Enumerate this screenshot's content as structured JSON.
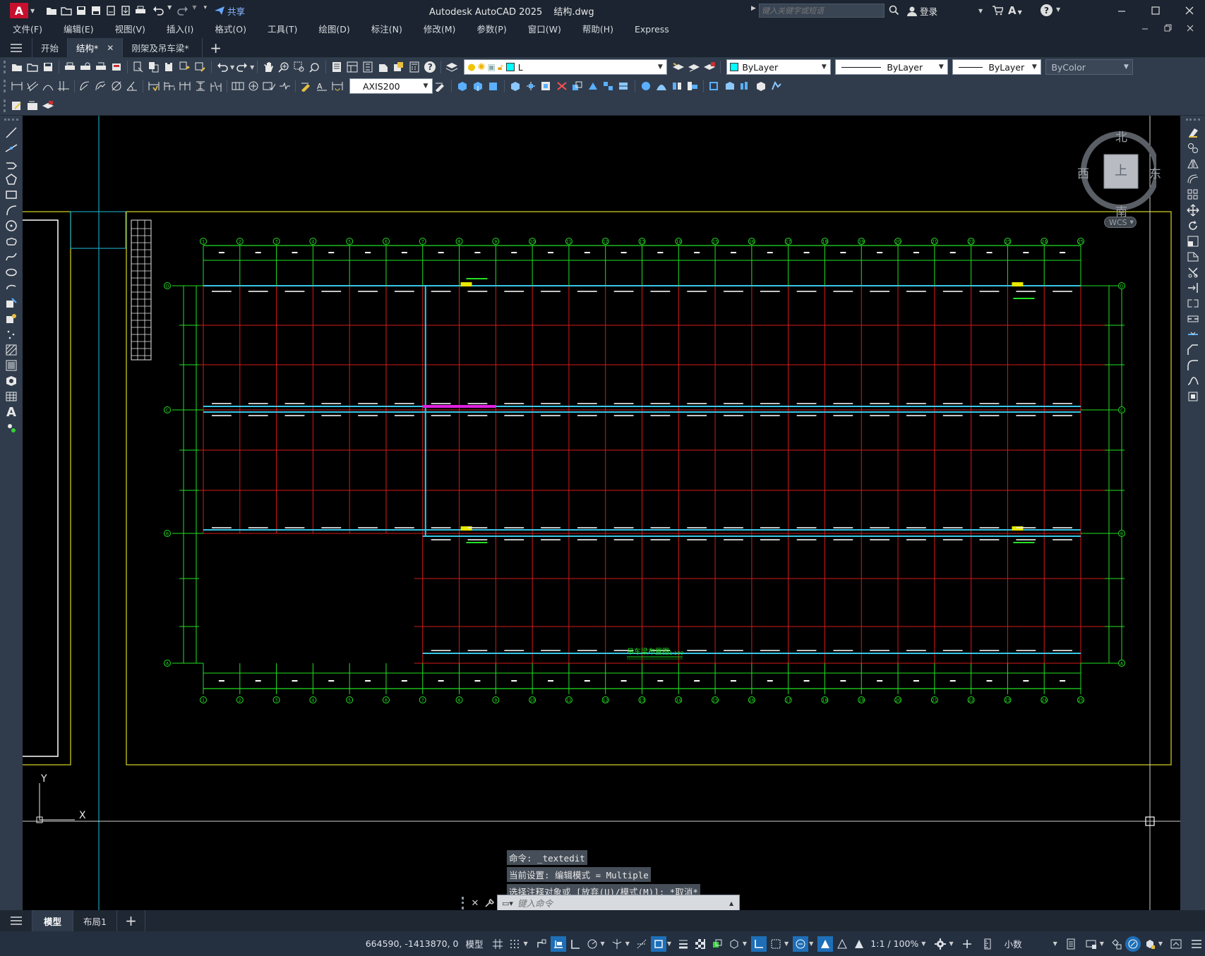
{
  "window": {
    "app_title": "Autodesk AutoCAD 2025",
    "file_name": "结构.dwg",
    "search_placeholder": "键入关键字或短语",
    "share_label": "共享",
    "login_label": "登录"
  },
  "menu": [
    "文件(F)",
    "编辑(E)",
    "视图(V)",
    "插入(I)",
    "格式(O)",
    "工具(T)",
    "绘图(D)",
    "标注(N)",
    "修改(M)",
    "参数(P)",
    "窗口(W)",
    "帮助(H)",
    "Express"
  ],
  "doc_tabs": [
    {
      "label": "开始",
      "active": false,
      "close": false
    },
    {
      "label": "结构*",
      "active": true,
      "close": true
    },
    {
      "label": "刚架及吊车梁*",
      "active": false,
      "close": false
    }
  ],
  "toolbar": {
    "layer_name": "L",
    "color": "ByLayer",
    "linetype": "ByLayer",
    "lineweight": "ByLayer",
    "plotstyle": "ByColor",
    "dim_style": "AXIS200"
  },
  "viewcube": {
    "north": "北",
    "south": "南",
    "east": "东",
    "west": "西",
    "face": "上",
    "wcs": "WCS"
  },
  "ucs": {
    "x": "X",
    "y": "Y"
  },
  "drawing": {
    "title": "吊车梁布置图",
    "scale": "1:100",
    "top_axes": [
      "1",
      "2",
      "3",
      "4",
      "5",
      "6",
      "7",
      "8",
      "9",
      "10",
      "11",
      "12",
      "13",
      "14",
      "15",
      "16",
      "17",
      "18",
      "19",
      "20",
      "21",
      "22",
      "23",
      "24",
      "25"
    ],
    "side_axes": [
      "D",
      "C",
      "B",
      "A"
    ]
  },
  "command": {
    "history": [
      "命令: _textedit",
      "当前设置: 编辑模式 = Multiple",
      "选择注释对象或 [放弃(U)/模式(M)]: *取消*"
    ],
    "placeholder": "键入命令"
  },
  "layout_tabs": [
    {
      "label": "模型",
      "active": true
    },
    {
      "label": "布局1",
      "active": false
    }
  ],
  "status": {
    "coords": "664590, -1413870, 0",
    "mode": "模型",
    "annotation_scale": "1:1 / 100%",
    "units": "小数"
  },
  "colors": {
    "background": "#000000",
    "axis_green": "#22e022",
    "grid_red": "#d61a1a",
    "beam_cyan": "#39c6e6",
    "frame_yellow": "#d8d820",
    "highlight_magenta": "#e020e0"
  }
}
